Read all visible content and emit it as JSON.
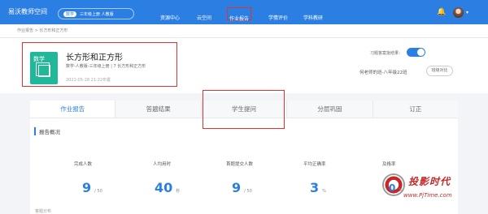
{
  "topbar": {
    "logo": "易沃教师空间",
    "subject_tag": "数学",
    "subject_selector": "三年级上册 人教版",
    "nav": [
      "资源中心",
      "云空间",
      "作业报告",
      "学情评价",
      "学科教研"
    ]
  },
  "breadcrumb": "作业报告  >  长方形和正方形",
  "homework": {
    "book_label": "数学",
    "title": "长方形和正方形",
    "meta": "数学-人教版-三年级上册   |   7 长方形和正方形",
    "date": "2021-05-28 21:22布置"
  },
  "options": {
    "toggle_label": "习题答案批结果：",
    "toggle_on": true,
    "class_name": "何老师的班-八年级22班",
    "switch_label": "班级对比"
  },
  "tabs": [
    "作业报告",
    "答题结果",
    "学生提问",
    "分层巩固",
    "订正"
  ],
  "active_tab": 0,
  "section_title": "报告概况",
  "stats": [
    {
      "label": "完成人数",
      "value": "9",
      "unit": "/ 50"
    },
    {
      "label": "人均用时",
      "value": "40",
      "unit": "秒"
    },
    {
      "label": "首题提交人数",
      "value": "9",
      "unit": "/ 50"
    },
    {
      "label": "平均正确率",
      "value": "3",
      "unit": "%"
    },
    {
      "label": "及格率",
      "value": "0",
      "unit": "%"
    }
  ],
  "more_label": "答题分布",
  "watermark": {
    "title": "投影时代",
    "url": "www.PjTime.com"
  },
  "colors": {
    "primary": "#2b7fe3",
    "highlight": "#e0332f",
    "book": "#21b899"
  }
}
